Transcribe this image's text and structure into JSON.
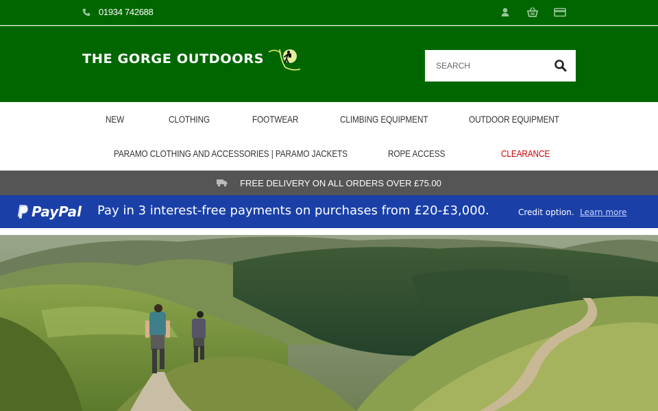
{
  "topbar": {
    "phone": "01934 742688",
    "icons": [
      "phone-icon",
      "user-icon",
      "basket-icon",
      "credit-card-icon"
    ]
  },
  "header": {
    "logo_text": "THE GORGE OUTDOORS",
    "search": {
      "placeholder": "SEARCH"
    }
  },
  "nav": {
    "items": [
      {
        "label": "NEW"
      },
      {
        "label": "CLOTHING"
      },
      {
        "label": "FOOTWEAR"
      },
      {
        "label": "CLIMBING EQUIPMENT"
      },
      {
        "label": "OUTDOOR EQUIPMENT"
      },
      {
        "label": "PARAMO CLOTHING AND ACCESSORIES | PARAMO JACKETS"
      },
      {
        "label": "ROPE ACCESS"
      },
      {
        "label": "CLEARANCE"
      }
    ]
  },
  "delivery": {
    "text": "FREE DELIVERY ON ALL ORDERS OVER £75.00"
  },
  "paypal": {
    "logo_text": "PayPal",
    "main": "Pay in 3 interest-free payments on purchases from £20-£3,000.",
    "sub": "Credit option.",
    "link": "Learn more"
  },
  "colors": {
    "brand_green": "#006700",
    "paypal_blue": "#1a40a8",
    "clearance_red": "#cc0000",
    "delivery_grey": "#555555"
  }
}
